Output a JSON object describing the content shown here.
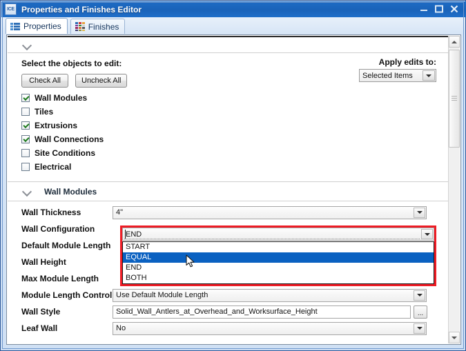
{
  "window": {
    "title": "Properties and Finishes Editor",
    "icon_label": "ICE",
    "minimize_label": "Minimize",
    "maximize_label": "Maximize",
    "close_label": "Close"
  },
  "tabs": [
    {
      "label": "Properties",
      "icon": "list-icon",
      "active": true
    },
    {
      "label": "Finishes",
      "icon": "color-grid-icon",
      "active": false
    }
  ],
  "select_section": {
    "title": "Select the objects to edit:",
    "check_all_label": "Check All",
    "uncheck_all_label": "Uncheck All",
    "apply_label": "Apply edits to:",
    "apply_value": "Selected Items",
    "items": [
      {
        "label": "Wall Modules",
        "checked": true
      },
      {
        "label": "Tiles",
        "checked": false
      },
      {
        "label": "Extrusions",
        "checked": true
      },
      {
        "label": "Wall Connections",
        "checked": true
      },
      {
        "label": "Site Conditions",
        "checked": false
      },
      {
        "label": "Electrical",
        "checked": false
      }
    ]
  },
  "wall_modules": {
    "section_title": "Wall Modules",
    "rows": [
      {
        "label": "Wall Thickness",
        "value": "4\"",
        "control": "combo"
      },
      {
        "label": "Wall Configuration",
        "value": "END",
        "control": "combo-open"
      },
      {
        "label": "Default Module Length",
        "value": "",
        "control": "combo"
      },
      {
        "label": "Wall Height",
        "value": "",
        "control": "combo"
      },
      {
        "label": "Max Module Length",
        "value": "",
        "control": "combo"
      },
      {
        "label": "Module Length Control",
        "value": "Use Default Module Length",
        "control": "combo"
      },
      {
        "label": "Wall Style",
        "value": "Solid_Wall_Antlers_at_Overhead_and_Worksurface_Height",
        "control": "text-browse"
      },
      {
        "label": "Leaf Wall",
        "value": "No",
        "control": "combo"
      }
    ],
    "browse_label": "..."
  },
  "dropdown": {
    "field_value": "END",
    "options": [
      {
        "label": "START",
        "selected": false
      },
      {
        "label": "EQUAL",
        "selected": true
      },
      {
        "label": "END",
        "selected": false
      },
      {
        "label": "BOTH",
        "selected": false
      }
    ],
    "highlight_color": "#ee1c25",
    "selection_color": "#0a61c1"
  },
  "colors": {
    "titlebar_blue": "#1a64bb",
    "accent_blue": "#2f6fb5",
    "check_green": "#1d7a1d"
  },
  "finishes_icon_colors": [
    "#2f6fb5",
    "#cf3c3c",
    "#e8a33d",
    "#7b3fa0",
    "#3f8f3f",
    "#d2d2d2",
    "#9c2b66",
    "#d8743c",
    "#5a5a5a",
    "#3a3a6e",
    "#8c8c3a",
    "#e0b84a"
  ]
}
